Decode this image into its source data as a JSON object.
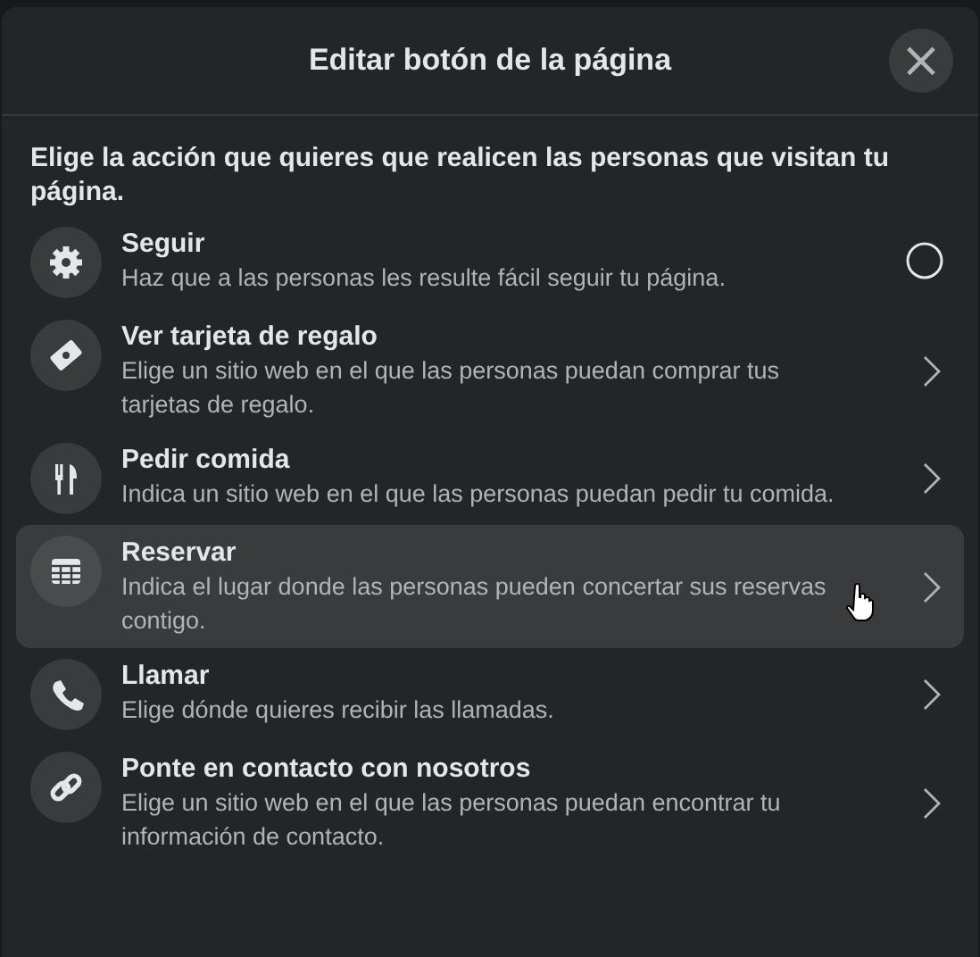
{
  "dialog": {
    "title": "Editar botón de la página",
    "close": "×"
  },
  "intro": "Elige la acción que quieres que realicen las personas que visitan tu página.",
  "options": [
    {
      "kind": "radio",
      "title": "Seguir",
      "description": "Haz que a las personas les resulte fácil seguir tu página.",
      "checked": false,
      "hovered": false
    },
    {
      "kind": "link",
      "title": "Ver tarjeta de regalo",
      "description": "Elige un sitio web en el que las personas puedan comprar tus tarjetas de regalo.",
      "hovered": false
    },
    {
      "kind": "link",
      "title": "Pedir comida",
      "description": "Indica un sitio web en el que las personas puedan pedir tu comida.",
      "hovered": false
    },
    {
      "kind": "link",
      "title": "Reservar",
      "description": "Indica el lugar donde las personas pueden concertar sus reservas contigo.",
      "hovered": true
    },
    {
      "kind": "link",
      "title": "Llamar",
      "description": "Elige dónde quieres recibir las llamadas.",
      "hovered": false
    },
    {
      "kind": "link",
      "title": "Ponte en contacto con nosotros",
      "description": "Elige un sitio web en el que las personas puedan encontrar tu información de contacto.",
      "hovered": false
    }
  ]
}
